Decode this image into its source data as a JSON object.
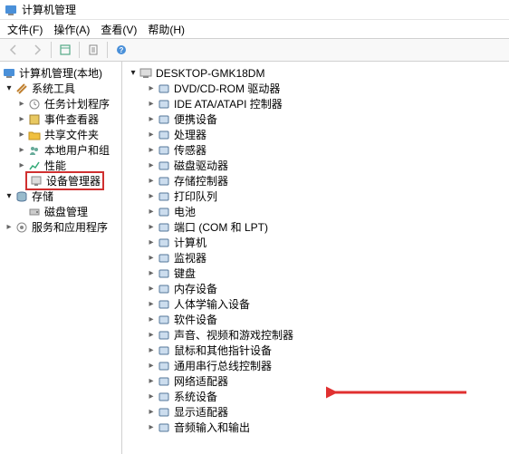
{
  "window": {
    "title": "计算机管理"
  },
  "menu": {
    "file": "文件(F)",
    "action": "操作(A)",
    "view": "查看(V)",
    "help": "帮助(H)"
  },
  "left_tree": {
    "root": "计算机管理(本地)",
    "system_tools": "系统工具",
    "task_scheduler": "任务计划程序",
    "event_viewer": "事件查看器",
    "shared_folders": "共享文件夹",
    "local_users": "本地用户和组",
    "performance": "性能",
    "device_manager": "设备管理器",
    "storage": "存储",
    "disk_mgmt": "磁盘管理",
    "services_apps": "服务和应用程序"
  },
  "right_tree": {
    "root": "DESKTOP-GMK18DM",
    "items": [
      "DVD/CD-ROM 驱动器",
      "IDE ATA/ATAPI 控制器",
      "便携设备",
      "处理器",
      "传感器",
      "磁盘驱动器",
      "存储控制器",
      "打印队列",
      "电池",
      "端口 (COM 和 LPT)",
      "计算机",
      "监视器",
      "键盘",
      "内存设备",
      "人体学输入设备",
      "软件设备",
      "声音、视频和游戏控制器",
      "鼠标和其他指针设备",
      "通用串行总线控制器",
      "网络适配器",
      "系统设备",
      "显示适配器",
      "音频输入和输出"
    ]
  }
}
